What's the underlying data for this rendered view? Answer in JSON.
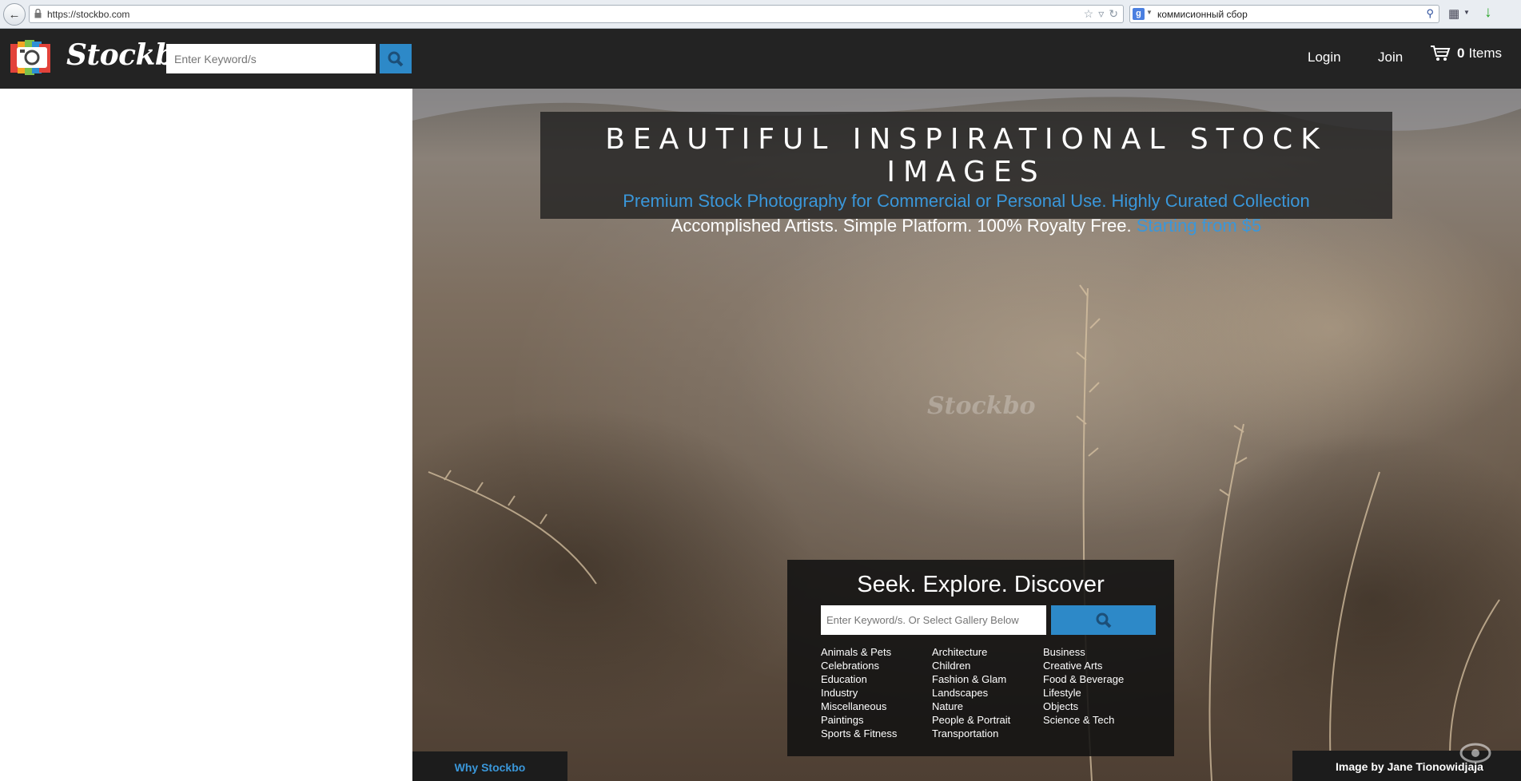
{
  "browser": {
    "url": "https://stockbo.com",
    "search_query": "коммисионный сбор"
  },
  "header": {
    "logo_text": "Stockbo",
    "search_placeholder": "Enter Keyword/s",
    "nav_login": "Login",
    "nav_join": "Join",
    "cart_count": "0",
    "cart_label": "Items"
  },
  "hero": {
    "title": "BEAUTIFUL INSPIRATIONAL STOCK IMAGES",
    "subtitle": "Premium Stock Photography for Commercial or Personal Use. Highly Curated Collection",
    "tagline": "Accomplished Artists. Simple Platform. 100% Royalty Free.",
    "price_text": "Starting from $5",
    "watermark": "Stockbo",
    "seek_title": "Seek. Explore. Discover",
    "seek_placeholder": "Enter Keyword/s. Or Select Gallery Below",
    "categories": [
      "Animals & Pets",
      "Architecture",
      "Business",
      "Celebrations",
      "Children",
      "Creative Arts",
      "Education",
      "Fashion & Glam",
      "Food & Beverage",
      "Industry",
      "Landscapes",
      "Lifestyle",
      "Miscellaneous",
      "Nature",
      "Objects",
      "Paintings",
      "People & Portrait",
      "Science & Tech",
      "Sports & Fitness",
      "Transportation"
    ],
    "why_tab": "Why Stockbo",
    "credit": "Image by Jane Tionowidjaja"
  }
}
